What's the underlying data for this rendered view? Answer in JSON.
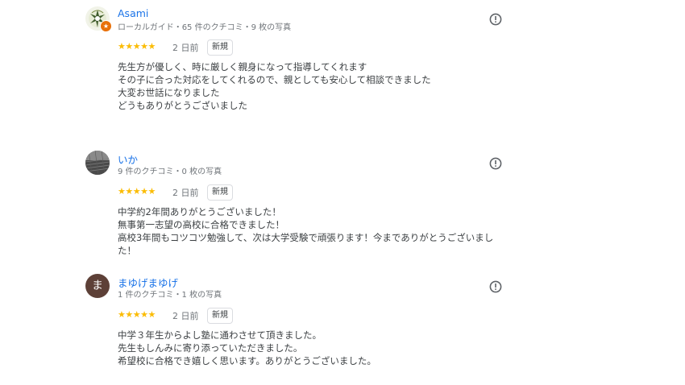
{
  "reviews": [
    {
      "name": "Asami",
      "meta": "ローカルガイド・65 件のクチコミ・9 枚の写真",
      "avatar_type": "image",
      "local_guide_badge_icon": "star-icon",
      "stars": "★★★★★",
      "rating": 5,
      "date": "2 日前",
      "new_label": "新規",
      "lines": [
        "先生方が優しく、時に厳しく親身になって指導してくれます",
        "その子に合った対応をしてくれるので、親としても安心して相談できました",
        "大変お世話になりました",
        "どうもありがとうございました"
      ]
    },
    {
      "name": "いか",
      "meta": "9 件のクチコミ・0 枚の写真",
      "avatar_type": "image",
      "stars": "★★★★★",
      "rating": 5,
      "date": "2 日前",
      "new_label": "新規",
      "lines": [
        "中学約2年間ありがとうございました！",
        "無事第一志望の高校に合格できました！",
        "高校3年間もコツコツ勉強して、次は大学受験で頑張ります！今までありがとうございまし",
        "た！"
      ]
    },
    {
      "name": "まゆげまゆげ",
      "meta": "1 件のクチコミ・1 枚の写真",
      "avatar_type": "letter",
      "avatar_letter": "ま",
      "avatar_color": "#5d4037",
      "stars": "★★★★★",
      "rating": 5,
      "date": "2 日前",
      "new_label": "新規",
      "lines": [
        "中学３年生からよし塾に通わさせて頂きました。",
        "先生もしんみに寄り添っていただきました。",
        "希望校に合格でき嬉しく思います。ありがとうございました。"
      ]
    }
  ],
  "icons": {
    "report": "report-icon"
  },
  "colors": {
    "name_link": "#1a73e8",
    "star": "#fbbc04",
    "meta_text": "#70757a",
    "body_text": "#3c4043",
    "badge": "#e8710a"
  }
}
